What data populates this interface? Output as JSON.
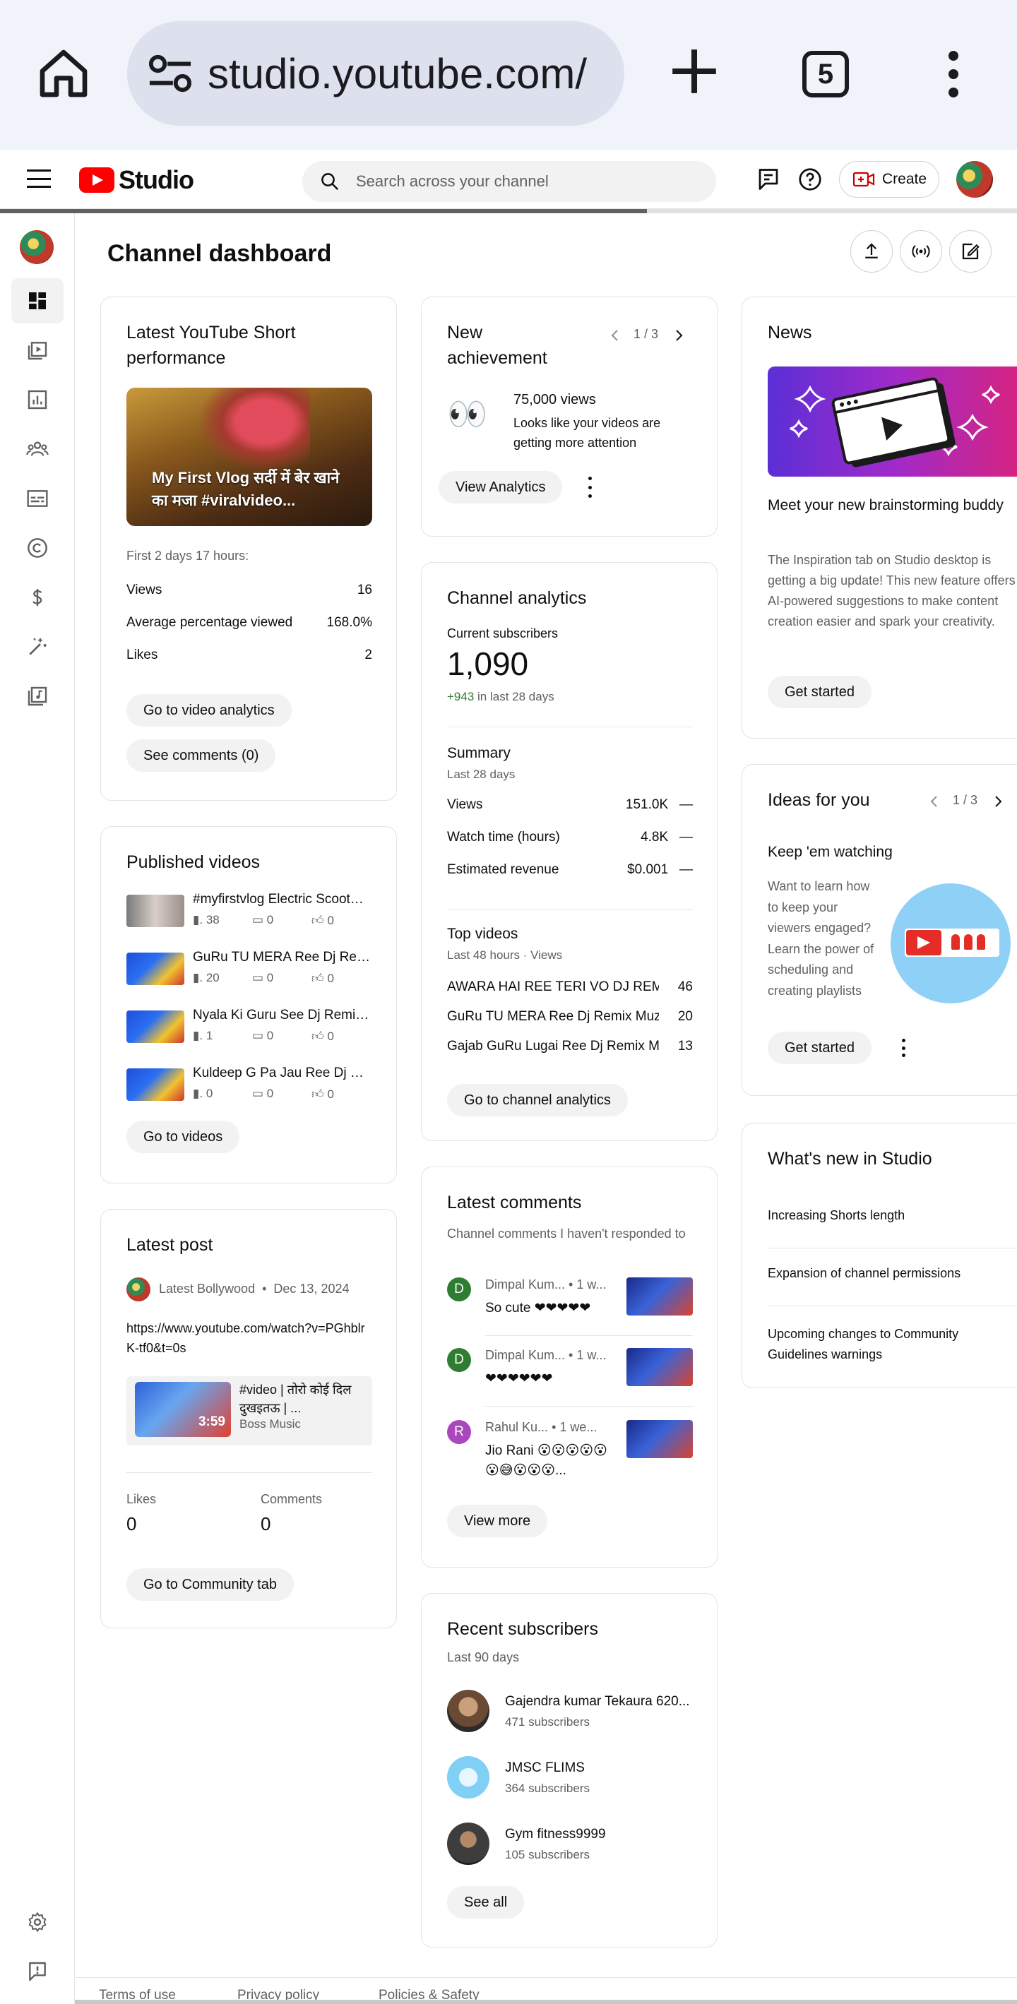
{
  "browser": {
    "url": "studio.youtube.com/",
    "tab_count": "5"
  },
  "header": {
    "logo_text": "Studio",
    "search_placeholder": "Search across your channel",
    "create_label": "Create"
  },
  "page": {
    "title": "Channel dashboard"
  },
  "short_card": {
    "title": "Latest YouTube Short performance",
    "thumb_title": "My First Vlog सर्दी में बेर खाने का मजा #viralvideo...",
    "period": "First 2 days 17 hours:",
    "stats": [
      {
        "label": "Views",
        "value": "16"
      },
      {
        "label": "Average percentage viewed",
        "value": "168.0%"
      },
      {
        "label": "Likes",
        "value": "2"
      }
    ],
    "btn_analytics": "Go to video analytics",
    "btn_comments": "See comments (0)"
  },
  "published": {
    "title": "Published videos",
    "videos": [
      {
        "title": "#myfirstvlog Electric Scooter...",
        "views": "38",
        "comments": "0",
        "likes": "0"
      },
      {
        "title": "GuRu TU MERA Ree Dj Remix...",
        "views": "20",
        "comments": "0",
        "likes": "0"
      },
      {
        "title": "Nyala Ki Guru See Dj Remix ...",
        "views": "1",
        "comments": "0",
        "likes": "0"
      },
      {
        "title": "Kuldeep G Pa Jau Ree Dj Re...",
        "views": "0",
        "comments": "0",
        "likes": "0"
      }
    ],
    "btn": "Go to videos"
  },
  "post": {
    "title": "Latest post",
    "author": "Latest Bollywood",
    "date": "Dec 13, 2024",
    "link": "https://www.youtube.com/watch?v=PGhblrK-tf0&t=0s",
    "video_title": "#video | तोरो कोई दिल दुखइतऊ | ...",
    "video_channel": "Boss Music",
    "video_duration": "3:59",
    "likes_label": "Likes",
    "likes": "0",
    "comments_label": "Comments",
    "comments": "0",
    "btn": "Go to Community tab"
  },
  "achievement": {
    "title": "New achievement",
    "pager": "1 / 3",
    "headline": "75,000 views",
    "text": "Looks like your videos are getting more attention",
    "btn": "View Analytics"
  },
  "analytics": {
    "title": "Channel analytics",
    "subs_label": "Current subscribers",
    "subs": "1,090",
    "subs_delta": "+943",
    "subs_delta_suffix": " in last 28 days",
    "summary_title": "Summary",
    "summary_period": "Last 28 days",
    "summary": [
      {
        "label": "Views",
        "value": "151.0K",
        "trend": "—"
      },
      {
        "label": "Watch time (hours)",
        "value": "4.8K",
        "trend": "—"
      },
      {
        "label": "Estimated revenue",
        "value": "$0.001",
        "trend": "—"
      }
    ],
    "top_title": "Top videos",
    "top_period": "Last 48 hours · Views",
    "top": [
      {
        "title": "AWARA HAI REE TERI VO DJ REMI...",
        "value": "46"
      },
      {
        "title": "GuRu TU MERA Ree Dj Remix Muzi...",
        "value": "20"
      },
      {
        "title": "Gajab GuRu Lugai Ree Dj Remix Mu...",
        "value": "13"
      }
    ],
    "btn": "Go to channel analytics"
  },
  "comments": {
    "title": "Latest comments",
    "subtitle": "Channel comments I haven't responded to",
    "items": [
      {
        "initial": "D",
        "color": "#2e7d32",
        "name": "Dimpal Kum...",
        "time": "• 1 w...",
        "text": "So cute ❤❤❤❤❤"
      },
      {
        "initial": "D",
        "color": "#2e7d32",
        "name": "Dimpal Kum...",
        "time": "• 1 w...",
        "text": "❤❤❤❤❤❤"
      },
      {
        "initial": "R",
        "color": "#ab47bc",
        "name": "Rahul Ku...",
        "time": "• 1 we...",
        "text": "Jio Rani 😮😮😮😮😮😮😅😮😮😮..."
      }
    ],
    "btn": "View more"
  },
  "subscribers": {
    "title": "Recent subscribers",
    "period": "Last 90 days",
    "items": [
      {
        "name": "Gajendra kumar Tekaura 620...",
        "count": "471 subscribers"
      },
      {
        "name": "JMSC FLIMS",
        "count": "364 subscribers"
      },
      {
        "name": "Gym fitness9999",
        "count": "105 subscribers"
      }
    ],
    "btn": "See all"
  },
  "news": {
    "title": "News",
    "headline": "Meet your new brainstorming buddy",
    "text": "The Inspiration tab on Studio desktop is getting a big update! This new feature offers AI-powered suggestions to make content creation easier and spark your creativity.",
    "btn": "Get started"
  },
  "ideas": {
    "title": "Ideas for you",
    "pager": "1 / 3",
    "headline": "Keep 'em watching",
    "text": "Want to learn how to keep your viewers engaged? Learn the power of scheduling and creating playlists",
    "btn": "Get started"
  },
  "whats_new": {
    "title": "What's new in Studio",
    "items": [
      "Increasing Shorts length",
      "Expansion of channel permissions",
      "Upcoming changes to Community Guidelines warnings"
    ]
  },
  "footer": {
    "terms": "Terms of use",
    "privacy": "Privacy policy",
    "policies": "Policies & Safety"
  }
}
